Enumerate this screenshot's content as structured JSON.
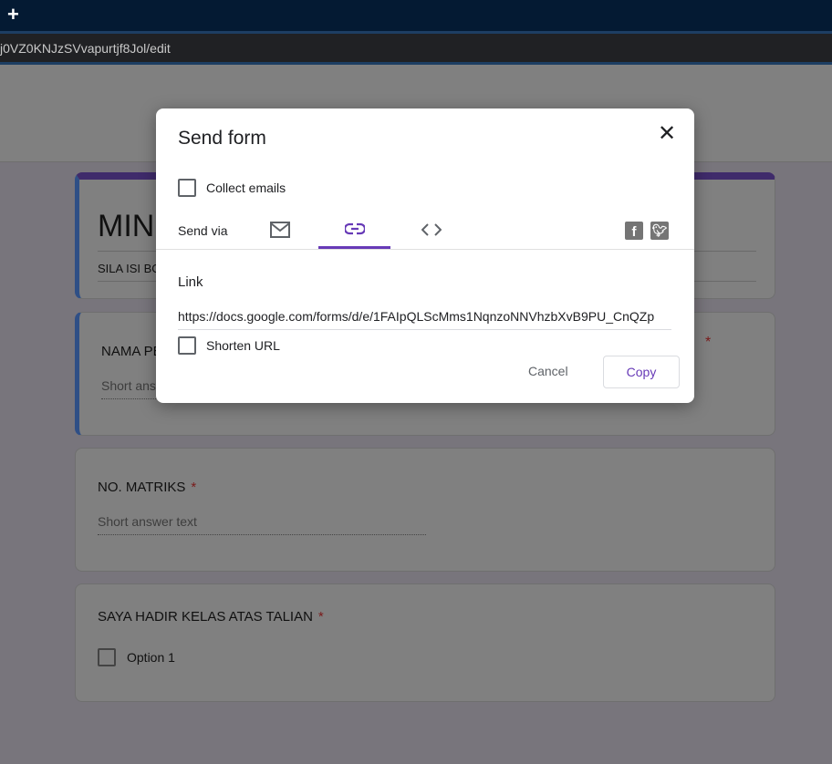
{
  "browser": {
    "new_tab_icon": "+",
    "url": "j0VZ0KNJzSVvapurtjf8Jol/edit"
  },
  "form": {
    "title": "MINGG",
    "description": "SILA ISI BO",
    "questions": [
      {
        "label": "NAMA PE",
        "required": "*",
        "placeholder": "Short answ"
      },
      {
        "label": "NO. MATRIKS",
        "required": "*",
        "placeholder": "Short answer text"
      },
      {
        "label": "SAYA HADIR KELAS ATAS TALIAN",
        "required": "*",
        "option": "Option 1"
      }
    ]
  },
  "dialog": {
    "title": "Send form",
    "close_icon": "✕",
    "collect_emails": "Collect emails",
    "send_via": "Send via",
    "tabs": [
      {
        "name": "email",
        "icon": "envelope"
      },
      {
        "name": "link",
        "icon": "link",
        "selected": true
      },
      {
        "name": "embed",
        "icon": "code"
      }
    ],
    "share": [
      "facebook",
      "twitter"
    ],
    "link_label": "Link",
    "link_url": "https://docs.google.com/forms/d/e/1FAIpQLScMms1NqnzoNNVhzbXvB9PU_CnQZp",
    "shorten_url": "Shorten URL",
    "cancel": "Cancel",
    "copy": "Copy",
    "accent": "#673ab7"
  }
}
